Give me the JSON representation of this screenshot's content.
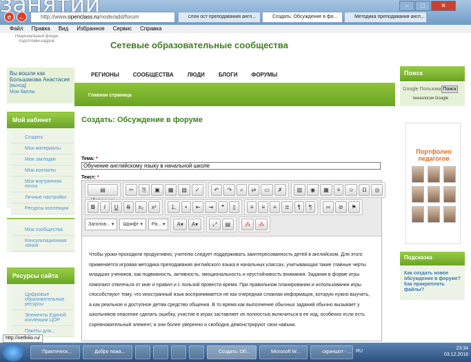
{
  "overlay_title": "занятии",
  "browser": {
    "address_prefix": "http://www.",
    "address_host": "openclass.ru",
    "address_path": "/node/add/forum",
    "tabs": [
      {
        "label": "слон ост преподавания англ..."
      },
      {
        "label": "Создать: Обсуждение в фо..."
      },
      {
        "label": "Методика преподавания англ..."
      }
    ],
    "menu": [
      "Файл",
      "Правка",
      "Вид",
      "Избранное",
      "Сервис",
      "Справка"
    ]
  },
  "site": {
    "fund_text": "Национальный фонда подготовки кадров",
    "title": "Сетевые образовательные сообщества",
    "nav": [
      "РЕГИОНЫ",
      "СООБЩЕСТВА",
      "ЛЮДИ",
      "БЛОГИ",
      "ФОРУМЫ"
    ],
    "breadcrumb": "Главная страница"
  },
  "user": {
    "logged_in_as": "Вы вошли как Большакова Анастасия",
    "logout": "[выход]",
    "points": "Мои баллы"
  },
  "cabinet": {
    "header": "Мой кабинет",
    "items": [
      "Создать",
      "Мои материалы",
      "Мои закладки",
      "Мои контакты",
      "Моя внутренняя почта",
      "Личные настройки",
      "Ресурсы коллекции"
    ]
  },
  "communities": {
    "items": [
      "Мои сообщества",
      "Консультационная линия"
    ]
  },
  "resources": {
    "header": "Ресурсы сайта",
    "items": [
      "Цифровые образовательные ресурсы",
      "Элементы Единой коллекции ЦОР",
      "Пакеты для..."
    ]
  },
  "page": {
    "title": "Создать: Обсуждение в форуме",
    "tema_label": "Тема:",
    "tema_value": "Обучение английскому языку в начальной школе",
    "text_label": "Текст:",
    "required_mark": "*"
  },
  "editor": {
    "source_label": "Источник",
    "format_combo": "Заголов...",
    "font_combo": "Шрифт",
    "size_combo": "Ра...",
    "content": "Чтобы уроки проходили продуктивно, учителю следует поддерживать заинтересованность детей в английском. Для этого применяется игровая методика преподавания английского языка в начальных классах, учитывающая такие главные черты младших учеников, как подвижность, активность, эмоциональность и неустойчивость внимания. Задания в форме игры помогают отвлечься от книг и правил и с пользой провести время. При правильном планировании и использовании игры способствуют тому, что иностранный язык воспринимается не как очередная сложная информация, которую нужно выучить, а как реальное и доступное детям средство общения. В то время как выполнение обычных заданий обычно вызывает у школьников опасение сделать ошибку, участие в играх заставляет их полностью включиться в ее ход, особенно если есть соревновательный элемент, и они более уверенно и свободно демонстрируют свои навыки."
  },
  "search": {
    "header": "Поиск",
    "google_text": "Google Пользовате",
    "button": "Поиск",
    "tech": "технология Google"
  },
  "portfolio": {
    "title_line1": "Портфолио",
    "title_line2": "педагогов"
  },
  "hint": {
    "header": "Подсказка",
    "link1": "Как создать новое обсуждение в форуме?",
    "link2": "Как прикреплять файлы?"
  },
  "status_url": "http://netfolio.ru/",
  "taskbar": {
    "tasks": [
      "Практическ...",
      "Добро пожа...",
      "Создать: Об...",
      "Microsoft W...",
      "скриншот - ..."
    ],
    "lang": "RU",
    "time": "23:34",
    "date": "03.12.2016"
  }
}
